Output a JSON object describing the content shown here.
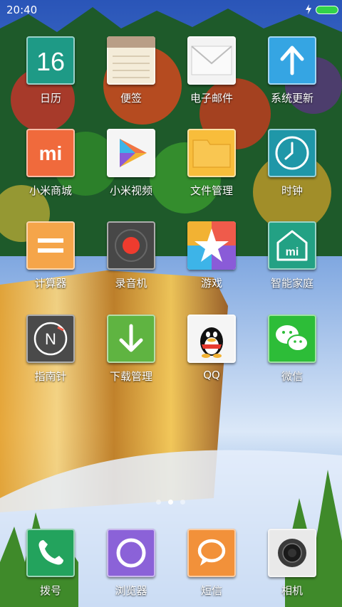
{
  "status_bar": {
    "time": "20:40",
    "battery_color": "#32d24a"
  },
  "grid_apps": [
    {
      "label": "日历",
      "icon": "calendar-icon",
      "badge": "16",
      "color": "#1e9a86"
    },
    {
      "label": "便签",
      "icon": "notes-icon",
      "color": "#f4ecd9"
    },
    {
      "label": "电子邮件",
      "icon": "email-icon",
      "color": "#f3f3f3"
    },
    {
      "label": "系统更新",
      "icon": "update-arrow-icon",
      "color": "#35a5e3"
    },
    {
      "label": "小米商城",
      "icon": "mi-store-icon",
      "badge": "mi",
      "color": "#f06a3c"
    },
    {
      "label": "小米视频",
      "icon": "video-play-icon",
      "color": "#f5f5f5"
    },
    {
      "label": "文件管理",
      "icon": "folder-icon",
      "color": "#f8bd3b"
    },
    {
      "label": "时钟",
      "icon": "clock-icon",
      "color": "#1f97a8"
    },
    {
      "label": "计算器",
      "icon": "calculator-icon",
      "color": "#f5a54a"
    },
    {
      "label": "录音机",
      "icon": "recorder-icon",
      "color": "#474747"
    },
    {
      "label": "游戏",
      "icon": "game-star-icon",
      "color": "#f2f2f2"
    },
    {
      "label": "智能家庭",
      "icon": "smart-home-icon",
      "badge": "mi",
      "color": "#23a184"
    },
    {
      "label": "指南针",
      "icon": "compass-icon",
      "badge": "N",
      "color": "#4a4a4a"
    },
    {
      "label": "下载管理",
      "icon": "download-icon",
      "color": "#5fb441"
    },
    {
      "label": "QQ",
      "icon": "qq-penguin-icon",
      "color": "#f5f5f5"
    },
    {
      "label": "微信",
      "icon": "wechat-icon",
      "color": "#2dbd38"
    }
  ],
  "page_indicator": {
    "pages": 3,
    "current": 2
  },
  "dock_apps": [
    {
      "label": "拨号",
      "icon": "phone-icon",
      "color": "#23a35d"
    },
    {
      "label": "浏览器",
      "icon": "browser-icon",
      "color": "#8b62d8"
    },
    {
      "label": "短信",
      "icon": "message-icon",
      "color": "#f2913a"
    },
    {
      "label": "相机",
      "icon": "camera-icon",
      "color": "#e9e9e9"
    }
  ]
}
